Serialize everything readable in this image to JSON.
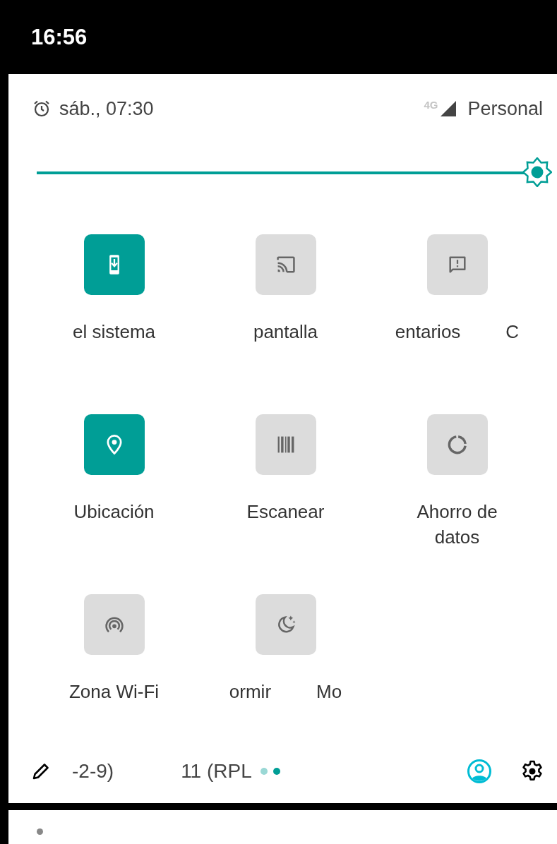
{
  "status_bar": {
    "time": "16:56"
  },
  "header": {
    "alarm": "sáb., 07:30",
    "network_type": "4G",
    "carrier": "Personal"
  },
  "brightness": {
    "level": 1
  },
  "tiles": [
    {
      "label": "el sistema",
      "on": true
    },
    {
      "label": "pantalla",
      "on": false
    },
    {
      "label": "entarios",
      "tail": "C",
      "on": false
    },
    {
      "label": "Ubicación",
      "on": true
    },
    {
      "label": "Escanear",
      "on": false
    },
    {
      "label": "Ahorro de datos",
      "on": false
    },
    {
      "label": "Zona Wi-Fi",
      "on": false
    },
    {
      "label": "ormir",
      "tail": "Mo",
      "on": false
    }
  ],
  "footer": {
    "build_fragments": [
      "-2-9)",
      "11 (RPL"
    ],
    "pages": [
      {
        "selected": false
      },
      {
        "selected": true
      }
    ]
  }
}
